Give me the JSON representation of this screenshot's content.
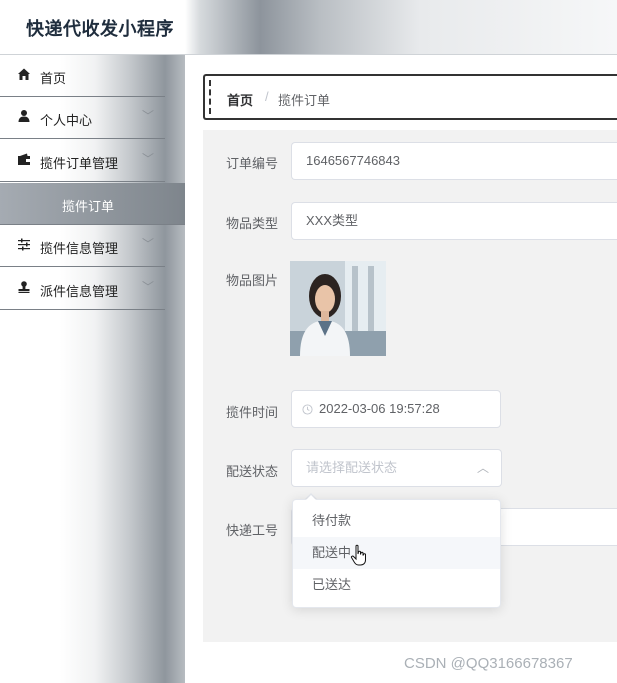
{
  "app": {
    "title": "快递代收发小程序"
  },
  "sidebar": {
    "items": [
      {
        "label": "首页",
        "icon": "home-icon",
        "has_chevron": false
      },
      {
        "label": "个人中心",
        "icon": "user-icon",
        "has_chevron": true
      },
      {
        "label": "揽件订单管理",
        "icon": "wallet-icon",
        "has_chevron": true
      },
      {
        "label": "揽件信息管理",
        "icon": "sliders-icon",
        "has_chevron": true
      },
      {
        "label": "派件信息管理",
        "icon": "stamp-icon",
        "has_chevron": true
      }
    ],
    "submenu": {
      "label": "揽件订单"
    }
  },
  "breadcrumb": {
    "home": "首页",
    "separator": "/",
    "current": "揽件订单"
  },
  "form": {
    "order_no": {
      "label": "订单编号",
      "value": "1646567746843"
    },
    "item_type": {
      "label": "物品类型",
      "value": "XXX类型"
    },
    "item_image": {
      "label": "物品图片"
    },
    "pickup_time": {
      "label": "揽件时间",
      "value": "2022-03-06 19:57:28"
    },
    "delivery_status": {
      "label": "配送状态",
      "placeholder": "请选择配送状态",
      "options": [
        "待付款",
        "配送中",
        "已送达"
      ],
      "hovered_option": "配送中"
    },
    "courier_no": {
      "label": "快递工号"
    }
  },
  "watermark": "CSDN @QQ3166678367",
  "colors": {
    "panel_bg": "#f2f2f2",
    "sidebar_active": "#8f969d",
    "text": "#606266"
  }
}
